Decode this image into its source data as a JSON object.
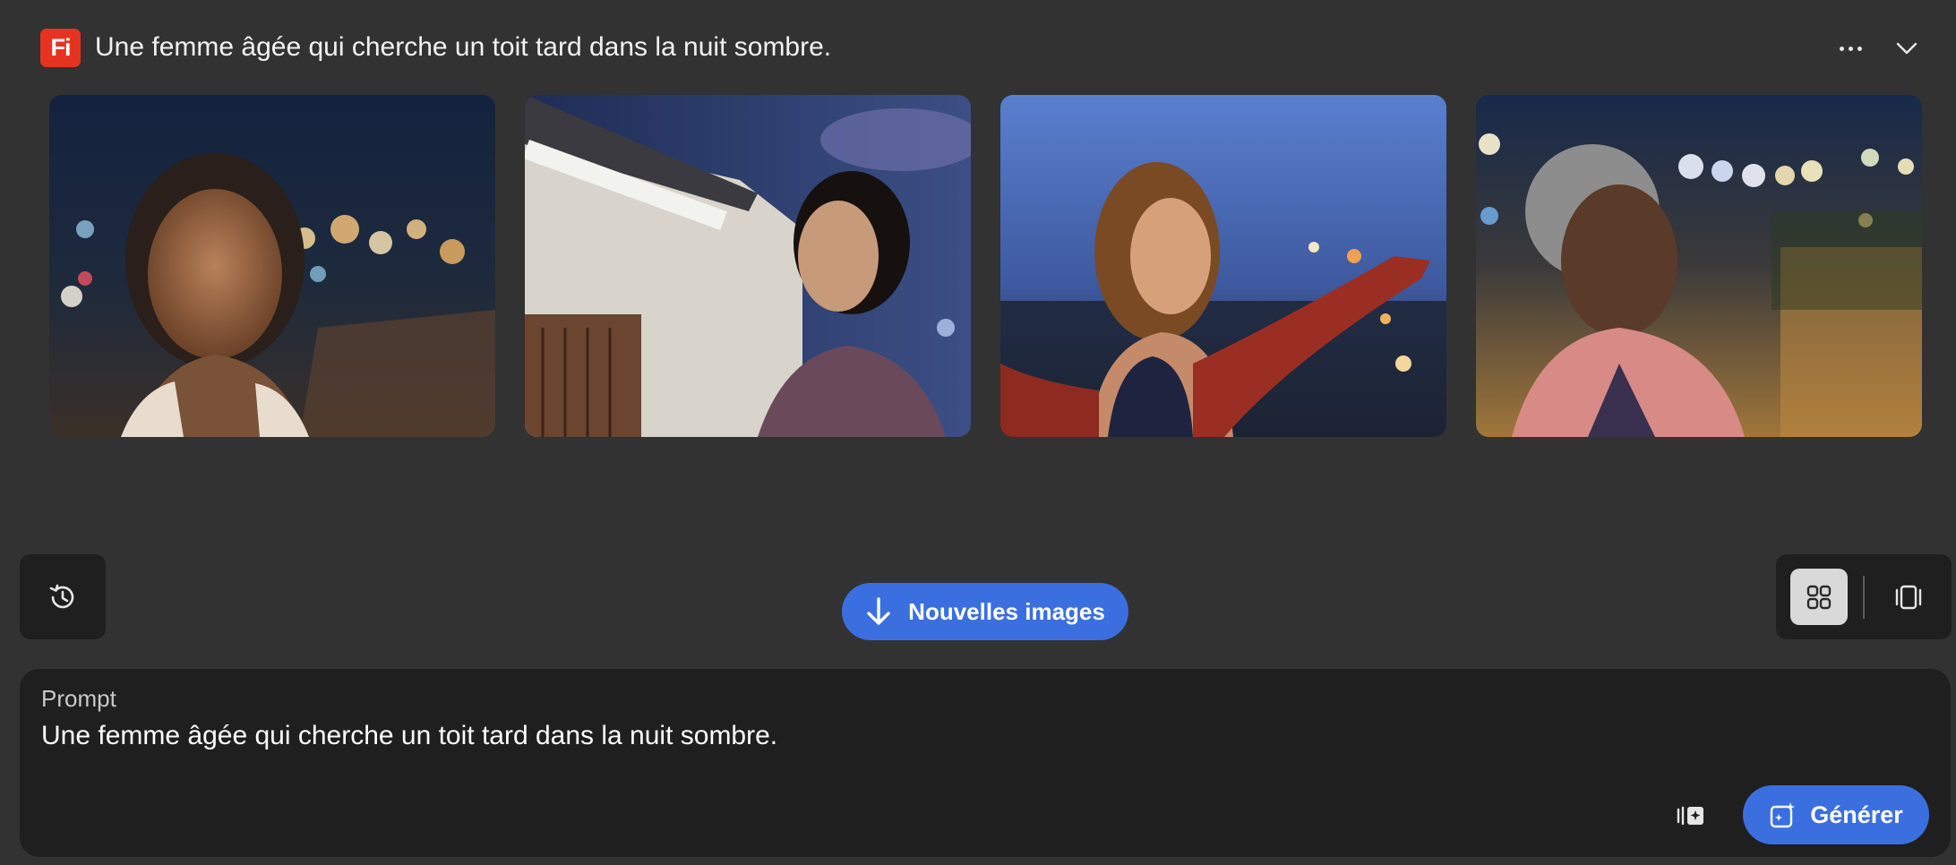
{
  "header": {
    "app_logo_text": "Fi",
    "title": "Une femme âgée qui cherche un toit tard dans la nuit sombre.",
    "more_icon": "more-horizontal-icon",
    "collapse_icon": "chevron-down-icon"
  },
  "gallery": {
    "images": [
      {
        "name": "generated-image-1"
      },
      {
        "name": "generated-image-2"
      },
      {
        "name": "generated-image-3"
      },
      {
        "name": "generated-image-4"
      }
    ]
  },
  "toolbar": {
    "history_icon": "history-icon",
    "new_images_label": "Nouvelles images",
    "new_images_icon": "arrow-down-icon",
    "grid_view_icon": "grid-icon",
    "carousel_view_icon": "carousel-icon",
    "active_view": "grid"
  },
  "prompt": {
    "label": "Prompt",
    "value": "Une femme âgée qui cherche un toit tard dans la nuit sombre.",
    "style_ref_icon": "style-reference-icon",
    "generate_label": "Générer",
    "generate_icon": "generate-sparkle-icon"
  },
  "colors": {
    "background": "#323232",
    "panel": "#1f1f1f",
    "accent": "#3b6fe0",
    "logo": "#e53322"
  }
}
